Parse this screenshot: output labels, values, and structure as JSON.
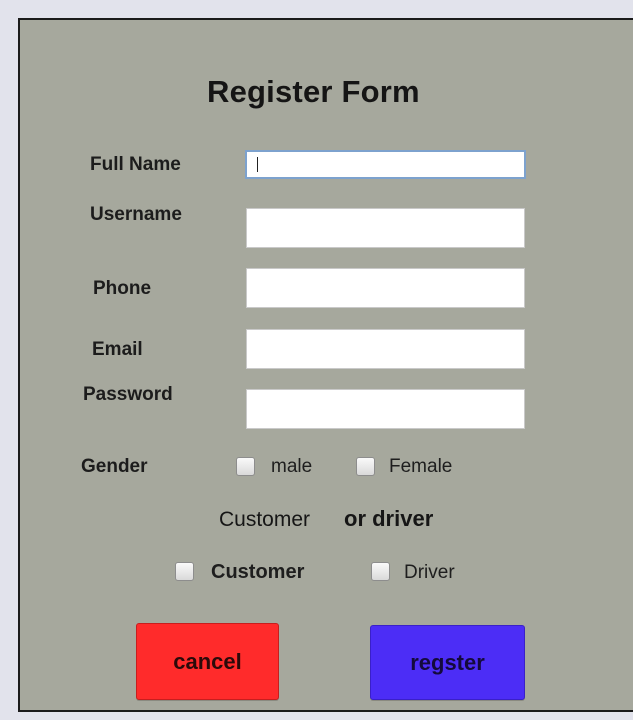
{
  "form": {
    "title": "Register Form",
    "fields": {
      "full_name": {
        "label": "Full Name",
        "value": ""
      },
      "username": {
        "label": "Username",
        "value": ""
      },
      "phone": {
        "label": "Phone",
        "value": ""
      },
      "email": {
        "label": "Email",
        "value": ""
      },
      "password": {
        "label": "Password",
        "value": ""
      }
    },
    "gender": {
      "label": "Gender",
      "options": [
        {
          "label": "male",
          "checked": false
        },
        {
          "label": "Female",
          "checked": false
        }
      ]
    },
    "role_prompt": {
      "part1": "Customer",
      "part2": "or driver"
    },
    "roles": [
      {
        "label": "Customer",
        "checked": false
      },
      {
        "label": "Driver",
        "checked": false
      }
    ],
    "buttons": {
      "cancel_label": "cancel",
      "register_label": "regster"
    }
  },
  "colors": {
    "panel_bg": "#a6a89d",
    "cancel_bg": "#ff2b2b",
    "register_bg": "#4c2df6",
    "focus_border": "#7da2ce"
  }
}
